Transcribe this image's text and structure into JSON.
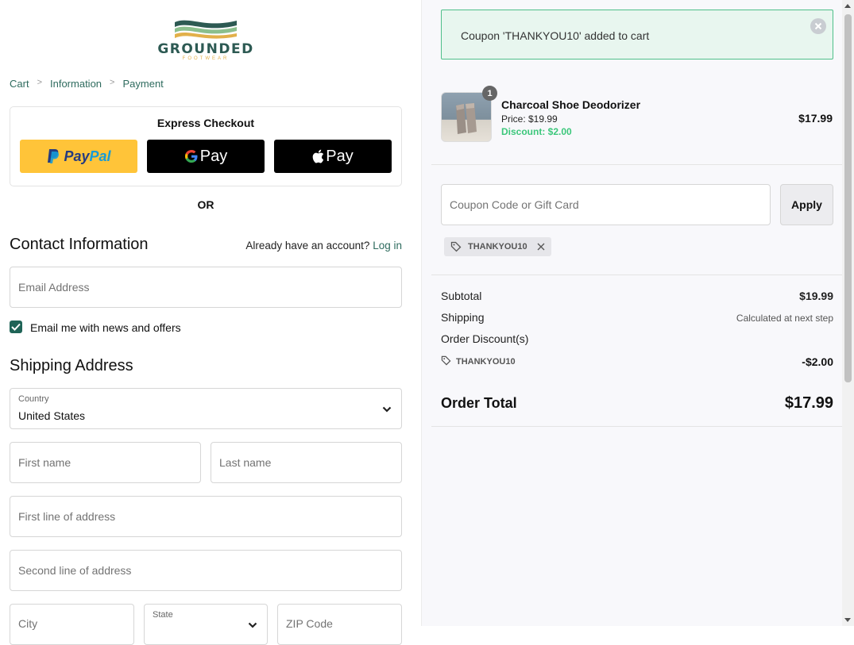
{
  "brand": {
    "name": "GROUNDED",
    "tagline": "FOOTWEAR"
  },
  "breadcrumb": [
    "Cart",
    "Information",
    "Payment"
  ],
  "express": {
    "title": "Express Checkout",
    "paypal_label_1": "Pay",
    "paypal_label_2": "Pal",
    "gpay_label": "Pay",
    "apay_label": "Pay"
  },
  "or_label": "OR",
  "contact": {
    "title": "Contact Information",
    "account_prompt": "Already have an account?",
    "login_link": "Log in",
    "email_placeholder": "Email Address",
    "newsletter_label": "Email me with news and offers",
    "newsletter_checked": true
  },
  "shipping": {
    "title": "Shipping Address",
    "country_label": "Country",
    "country_value": "United States",
    "first_name_placeholder": "First name",
    "last_name_placeholder": "Last name",
    "address1_placeholder": "First line of address",
    "address2_placeholder": "Second line of address",
    "city_placeholder": "City",
    "state_label": "State",
    "zip_placeholder": "ZIP Code"
  },
  "toast": {
    "message": "Coupon 'THANKYOU10' added to cart"
  },
  "cart_item": {
    "quantity": "1",
    "name": "Charcoal Shoe Deodorizer",
    "price": "Price: $19.99",
    "discount": "Discount: $2.00",
    "line_total": "$17.99"
  },
  "coupon": {
    "placeholder": "Coupon Code or Gift Card",
    "apply_label": "Apply",
    "applied_code": "THANKYOU10"
  },
  "summary": {
    "subtotal_label": "Subtotal",
    "subtotal_value": "$19.99",
    "shipping_label": "Shipping",
    "shipping_value": "Calculated at next step",
    "discounts_label": "Order Discount(s)",
    "discount_code": "THANKYOU10",
    "discount_value": "-$2.00",
    "total_label": "Order Total",
    "total_value": "$17.99"
  },
  "colors": {
    "accent": "#2e6b5e",
    "checkbox": "#1f6457",
    "discount_green": "#3cc77b",
    "toast_border": "#4fbf8a",
    "toast_bg": "#e8f6ef",
    "paypal_yellow": "#ffc439"
  }
}
